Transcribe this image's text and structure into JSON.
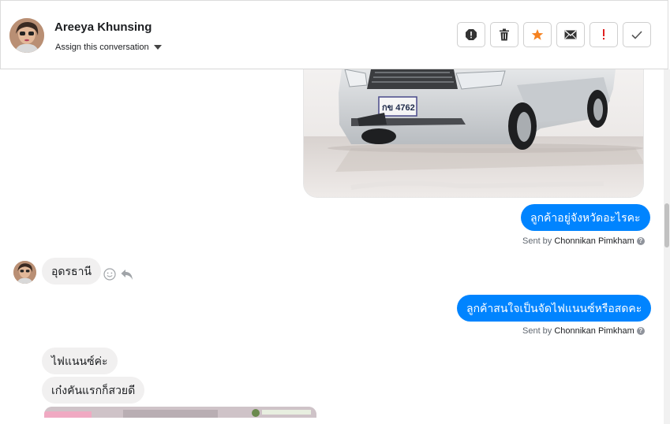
{
  "header": {
    "contact_name": "Areeya Khunsing",
    "assign_label": "Assign this conversation",
    "actions": [
      {
        "name": "spam-icon"
      },
      {
        "name": "trash-icon"
      },
      {
        "name": "star-icon"
      },
      {
        "name": "envelope-icon"
      },
      {
        "name": "exclamation-icon"
      },
      {
        "name": "checkmark-icon"
      }
    ]
  },
  "colors": {
    "outgoing_bubble": "#0084ff",
    "incoming_bubble": "#f1f0f0",
    "star": "#f58220",
    "alert": "#e02020"
  },
  "messages": {
    "car_plate": "กข 4762",
    "out1": "ลูกค้าอยู่จังหวัดอะไรคะ",
    "sent1_prefix": "Sent by",
    "sent1_name": "Chonnikan Pimkham",
    "in1": "อุดรธานี",
    "out2": "ลูกค้าสนใจเป็นจัดไฟแนนซ์หรือสดคะ",
    "sent2_prefix": "Sent by",
    "sent2_name": "Chonnikan Pimkham",
    "in2": "ไฟแนนซ์ค่ะ",
    "in3": "เก๋งคันแรกก็สวยดี",
    "help_glyph": "?"
  }
}
